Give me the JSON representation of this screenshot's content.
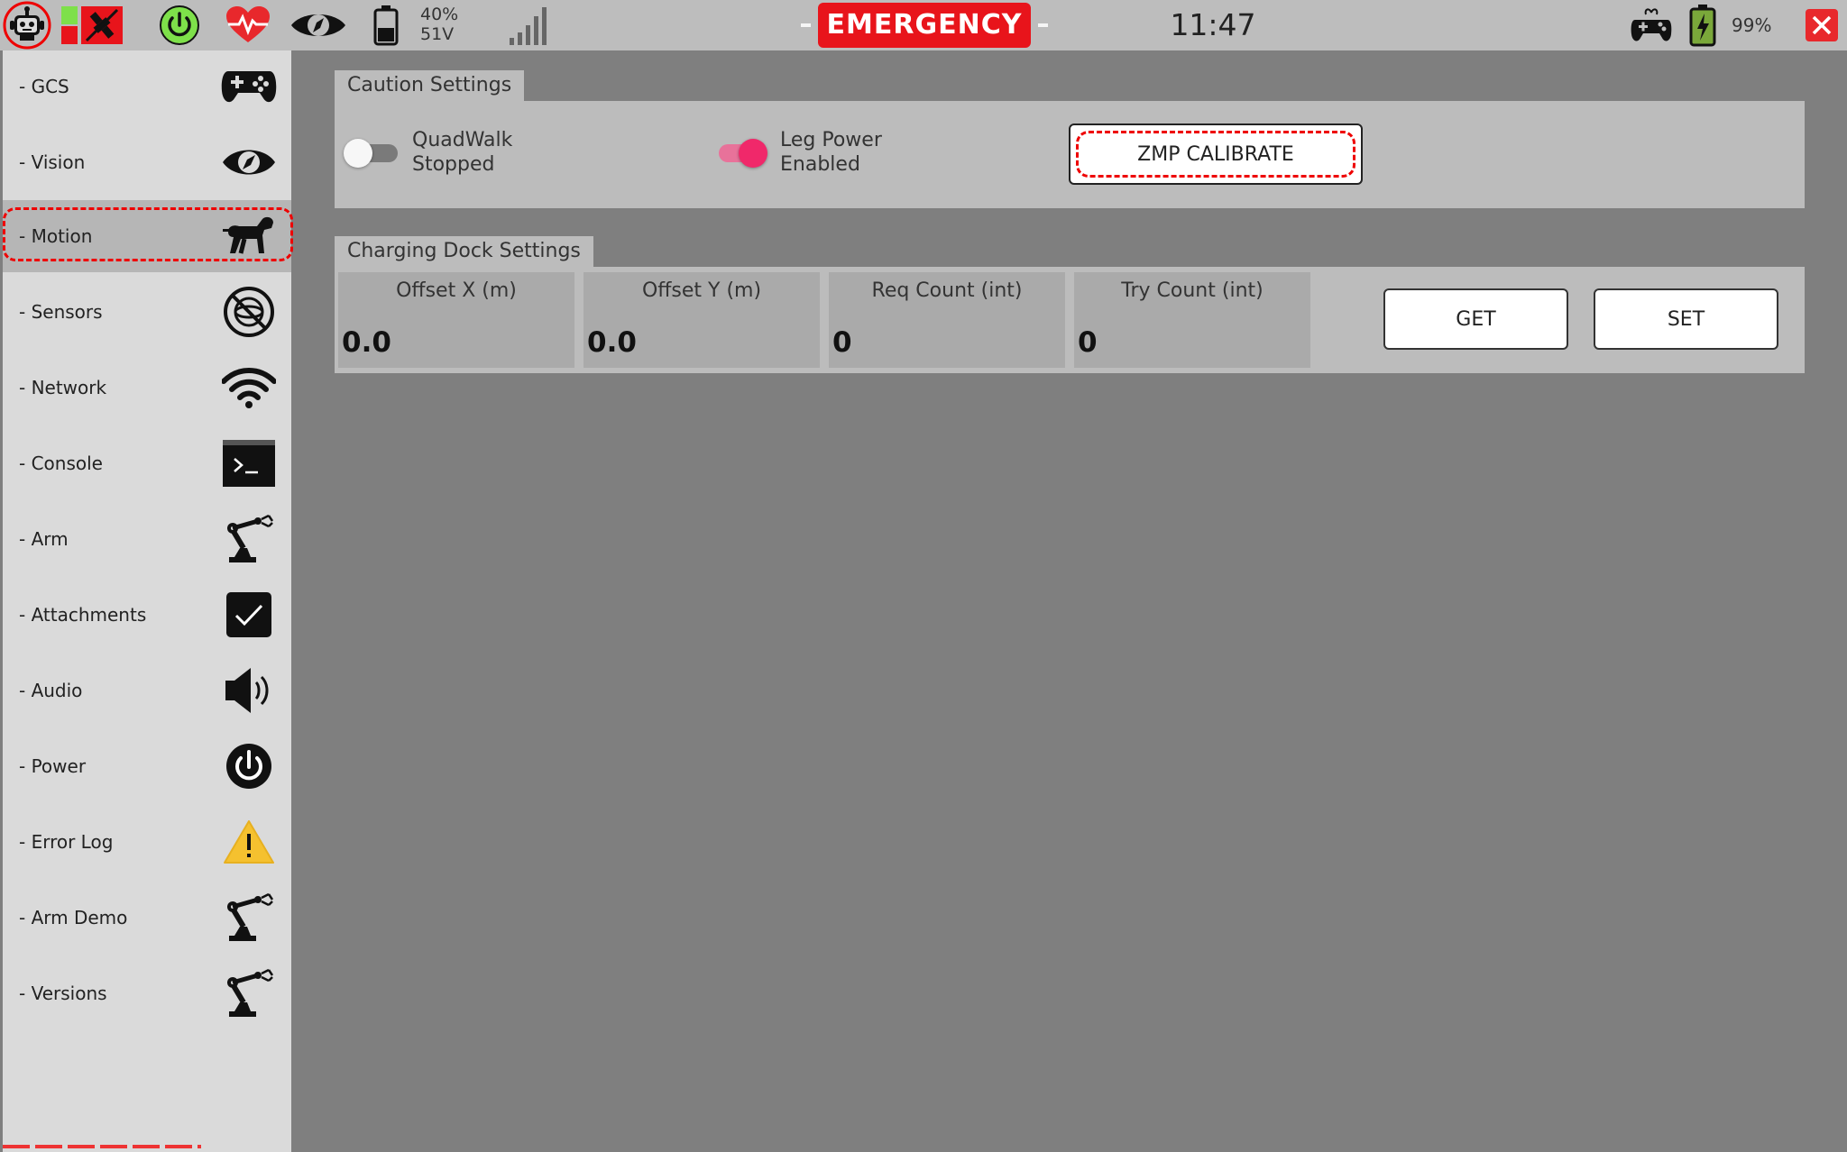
{
  "topbar": {
    "battery_percent": "40%",
    "battery_voltage": "51V",
    "emergency_label": "EMERGENCY",
    "clock": "11:47",
    "controller_battery_percent": "99%",
    "icons": [
      "robot-icon",
      "connection-status-icon",
      "power-icon",
      "heartbeat-icon",
      "vision-eye-icon",
      "battery-icon",
      "signal-strength-icon",
      "gamepad-icon",
      "charging-battery-icon",
      "close-icon"
    ],
    "colors": {
      "emergency": "#e8141b",
      "power_ok": "#2ecc40",
      "heartbeat": "#e8282c",
      "close": "#e8282c"
    }
  },
  "sidebar": {
    "items": [
      {
        "label": "- GCS",
        "icon": "gamepad-icon"
      },
      {
        "label": "- Vision",
        "icon": "eye-compass-icon"
      },
      {
        "label": "- Motion",
        "icon": "robot-dog-icon",
        "active": true
      },
      {
        "label": "- Sensors",
        "icon": "sensor-off-icon"
      },
      {
        "label": "- Network",
        "icon": "wifi-icon"
      },
      {
        "label": "- Console",
        "icon": "terminal-icon"
      },
      {
        "label": "- Arm",
        "icon": "robot-arm-icon"
      },
      {
        "label": "- Attachments",
        "icon": "checkbox-icon"
      },
      {
        "label": "- Audio",
        "icon": "speaker-icon"
      },
      {
        "label": "- Power",
        "icon": "power-icon"
      },
      {
        "label": "- Error Log",
        "icon": "warning-icon"
      },
      {
        "label": "- Arm Demo",
        "icon": "robot-arm-icon"
      },
      {
        "label": "- Versions",
        "icon": "robot-arm-icon"
      }
    ]
  },
  "caution": {
    "title": "Caution Settings",
    "quadwalk": {
      "line1": "QuadWalk",
      "line2": "Stopped",
      "on": false
    },
    "leg_power": {
      "line1": "Leg Power",
      "line2": "Enabled",
      "on": true
    },
    "zmp_label": "ZMP CALIBRATE",
    "toggle_on_color": "#f0286a"
  },
  "dock": {
    "title": "Charging Dock Settings",
    "fields": [
      {
        "label": "Offset X (m)",
        "value": "0.0"
      },
      {
        "label": "Offset Y (m)",
        "value": "0.0"
      },
      {
        "label": "Req Count (int)",
        "value": "0"
      },
      {
        "label": "Try Count (int)",
        "value": "0"
      }
    ],
    "get_label": "GET",
    "set_label": "SET"
  }
}
